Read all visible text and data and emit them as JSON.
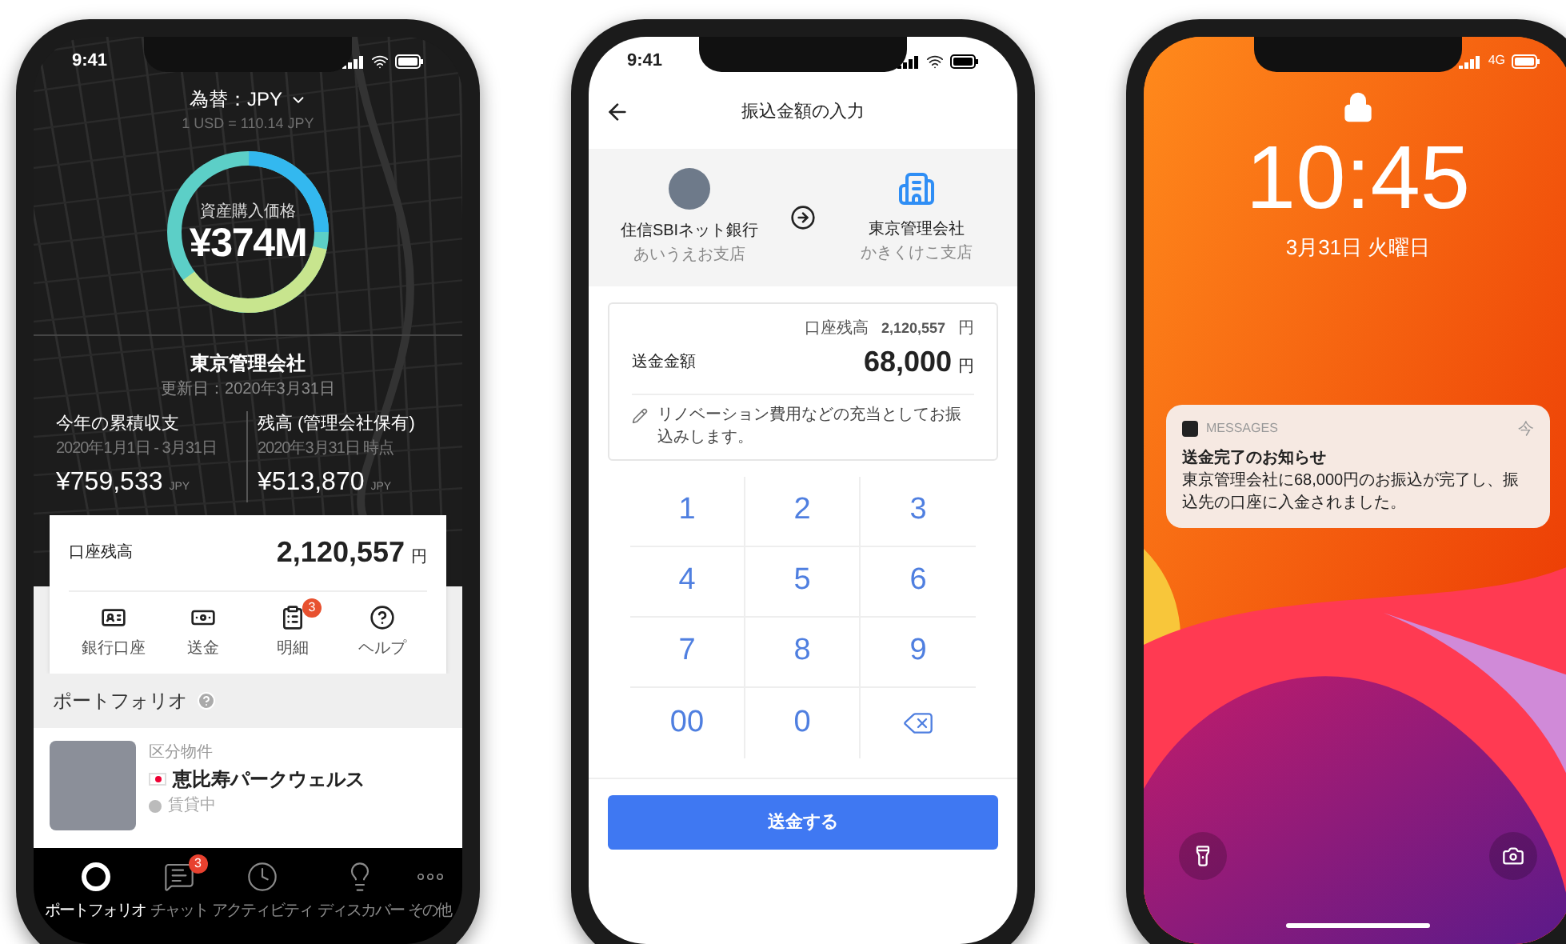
{
  "portfolio_screen": {
    "status_time": "9:41",
    "currency_selector": "為替：JPY",
    "exchange_rate": "1 USD = 110.14 JPY",
    "donut_label": "資産購入価格",
    "donut_value": "¥374M",
    "company": "東京管理会社",
    "updated": "更新日：2020年3月31日",
    "stats": [
      {
        "title": "今年の累積収支",
        "period": "2020年1月1日 - 3月31日",
        "amount": "¥759,533",
        "unit": "JPY"
      },
      {
        "title": "残高 (管理会社保有)",
        "period": "2020年3月31日 時点",
        "amount": "¥513,870",
        "unit": "JPY"
      }
    ],
    "balance": {
      "label": "口座残高",
      "amount": "2,120,557",
      "unit": "円"
    },
    "actions": [
      {
        "kind": "bank",
        "label": "銀行口座"
      },
      {
        "kind": "send",
        "label": "送金"
      },
      {
        "kind": "statement",
        "label": "明細",
        "badge": "3"
      },
      {
        "kind": "help",
        "label": "ヘルプ"
      }
    ],
    "section_title": "ポートフォリオ",
    "property": {
      "category": "区分物件",
      "name": "恵比寿パークウェルス",
      "status": "賃貸中"
    },
    "tabs": [
      {
        "kind": "portfolio",
        "label": "ポートフォリオ",
        "selected": true
      },
      {
        "kind": "chat",
        "label": "チャット",
        "badge": "3",
        "selected": false
      },
      {
        "kind": "activity",
        "label": "アクティビティ",
        "selected": false
      },
      {
        "kind": "discover",
        "label": "ディスカバー",
        "selected": false
      },
      {
        "kind": "more",
        "label": "その他",
        "selected": false
      }
    ]
  },
  "transfer_screen": {
    "status_time": "9:41",
    "title": "振込金額の入力",
    "from": {
      "bank": "住信SBIネット銀行",
      "branch": "あいうえお支店"
    },
    "to": {
      "bank": "東京管理会社",
      "branch": "かきくけこ支店"
    },
    "balance": {
      "label": "口座残高",
      "amount": "2,120,557",
      "unit": "円"
    },
    "amount": {
      "label": "送金金額",
      "value": "68,000",
      "unit": "円"
    },
    "memo": "リノベーション費用などの充当としてお振込みします。",
    "keys": [
      {
        "kind": "digit",
        "label": "1"
      },
      {
        "kind": "digit",
        "label": "2"
      },
      {
        "kind": "digit",
        "label": "3"
      },
      {
        "kind": "digit",
        "label": "4"
      },
      {
        "kind": "digit",
        "label": "5"
      },
      {
        "kind": "digit",
        "label": "6"
      },
      {
        "kind": "digit",
        "label": "7"
      },
      {
        "kind": "digit",
        "label": "8"
      },
      {
        "kind": "digit",
        "label": "9"
      },
      {
        "kind": "digit",
        "label": "00"
      },
      {
        "kind": "digit",
        "label": "0"
      },
      {
        "kind": "backspace"
      }
    ],
    "submit": "送金する"
  },
  "lock_screen": {
    "network": "4G",
    "time": "10:45",
    "date": "3月31日 火曜日",
    "notification": {
      "app": "MESSAGES",
      "when": "今",
      "title": "送金完了のお知らせ",
      "body": "東京管理会社に68,000円のお振込が完了し、振込先の口座に入金されました。"
    }
  }
}
